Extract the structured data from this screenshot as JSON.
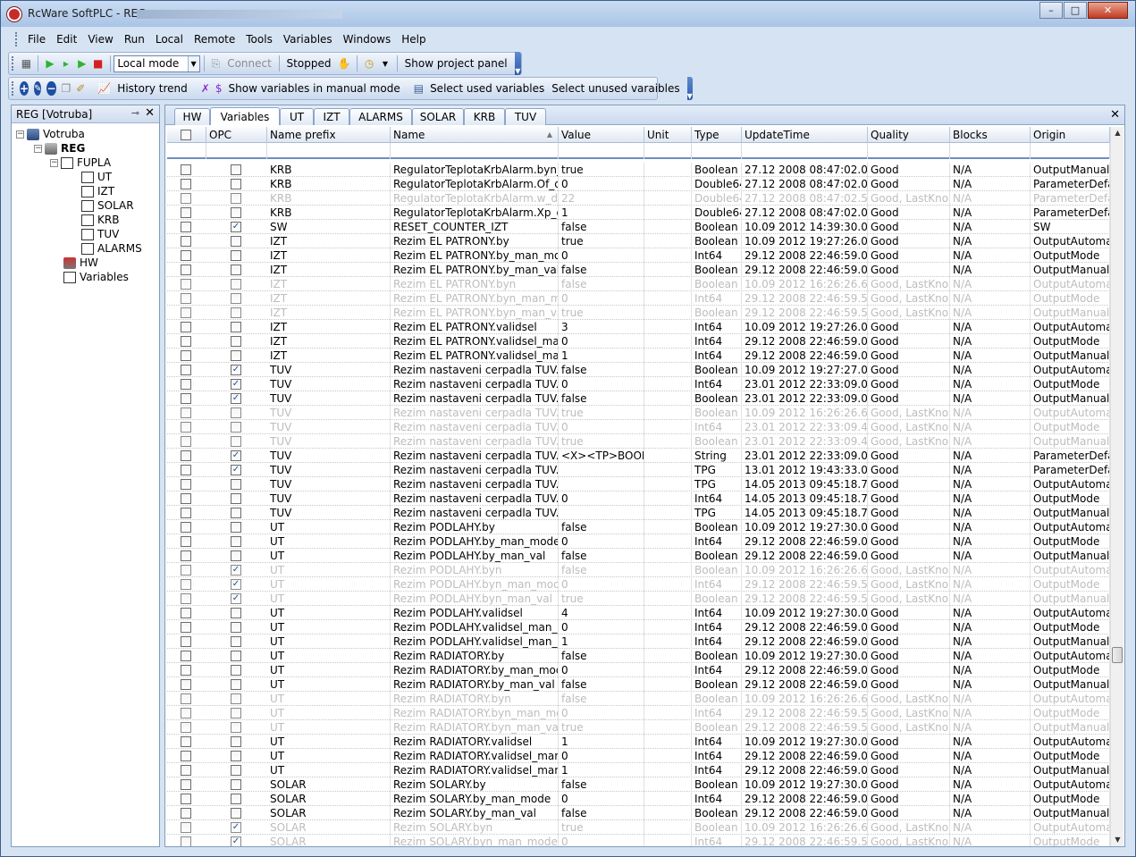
{
  "window": {
    "title": "RcWare SoftPLC - REG",
    "min": "–",
    "max": "□",
    "close": "✕"
  },
  "menu": [
    "File",
    "Edit",
    "View",
    "Run",
    "Local",
    "Remote",
    "Tools",
    "Variables",
    "Windows",
    "Help"
  ],
  "toolbar1": {
    "mode": "Local mode",
    "connect": "Connect",
    "stopped": "Stopped",
    "show_project_panel": "Show project panel"
  },
  "toolbar2": {
    "history_trend": "History trend",
    "show_manual": "Show variables in manual mode",
    "select_used": "Select used variables",
    "select_unused": "Select unused varaibles"
  },
  "left_panel": {
    "title": "REG [Votruba]",
    "tree": {
      "root": "Votruba",
      "reg": "REG",
      "fupla": "FUPLA",
      "children": [
        "UT",
        "IZT",
        "SOLAR",
        "KRB",
        "TUV",
        "ALARMS"
      ],
      "hw": "HW",
      "variables": "Variables"
    }
  },
  "tabs": [
    "HW",
    "Variables",
    "UT",
    "IZT",
    "ALARMS",
    "SOLAR",
    "KRB",
    "TUV"
  ],
  "active_tab": "Variables",
  "columns": [
    "OPC",
    "Name prefix",
    "Name",
    "Value",
    "Unit",
    "Type",
    "UpdateTime",
    "Quality",
    "Blocks",
    "Origin"
  ],
  "rows": [
    [
      "0",
      "KRB",
      "RegulatorTeplotaKrbAlarm.byn_m...",
      "true",
      "",
      "Boolean",
      "27.12 2008 08:47:02.000",
      "Good",
      "N/A",
      "OutputManual..."
    ],
    [
      "0",
      "KRB",
      "RegulatorTeplotaKrbAlarm.Of_def...",
      "0",
      "",
      "Double64",
      "27.12 2008 08:47:02.000",
      "Good",
      "N/A",
      "ParameterDefa..."
    ],
    [
      "d0",
      "KRB",
      "RegulatorTeplotaKrbAlarm.w_defa...",
      "22",
      "",
      "Double64",
      "27.12 2008 08:47:02.500",
      "Good, LastKno...",
      "N/A",
      "ParameterDefa..."
    ],
    [
      "0",
      "KRB",
      "RegulatorTeplotaKrbAlarm.Xp_def...",
      "1",
      "",
      "Double64",
      "27.12 2008 08:47:02.000",
      "Good",
      "N/A",
      "ParameterDefa..."
    ],
    [
      "1",
      "SW",
      "RESET_COUNTER_IZT",
      "false",
      "",
      "Boolean",
      "10.09 2012 14:39:30.000",
      "Good",
      "N/A",
      "SW"
    ],
    [
      "0",
      "IZT",
      "Rezim EL PATRONY.by",
      "true",
      "",
      "Boolean",
      "10.09 2012 19:27:26.000",
      "Good",
      "N/A",
      "OutputAutomat..."
    ],
    [
      "0",
      "IZT",
      "Rezim  EL  PATRONY.by_man_mo...",
      "0",
      "",
      "Int64",
      "29.12 2008 22:46:59.000",
      "Good",
      "N/A",
      "OutputMode"
    ],
    [
      "0",
      "IZT",
      "Rezim EL PATRONY.by_man_val",
      "false",
      "",
      "Boolean",
      "29.12 2008 22:46:59.000",
      "Good",
      "N/A",
      "OutputManual..."
    ],
    [
      "d0",
      "IZT",
      "Rezim  EL  PATRONY.byn",
      "false",
      "",
      "Boolean",
      "10.09 2012 16:26:26.609",
      "Good, LastKno...",
      "N/A",
      "OutputAutomat..."
    ],
    [
      "d0",
      "IZT",
      "Rezim  EL  PATRONY.byn_man_m...",
      "0",
      "",
      "Int64",
      "29.12 2008 22:46:59.546",
      "Good, LastKno...",
      "N/A",
      "OutputMode"
    ],
    [
      "d0",
      "IZT",
      "Rezim  EL  PATRONY.byn_man_val",
      "true",
      "",
      "Boolean",
      "29.12 2008 22:46:59.546",
      "Good, LastKno...",
      "N/A",
      "OutputManual..."
    ],
    [
      "0",
      "IZT",
      "Rezim EL PATRONY.validsel",
      "3",
      "",
      "Int64",
      "10.09 2012 19:27:26.000",
      "Good",
      "N/A",
      "OutputAutomat..."
    ],
    [
      "0",
      "IZT",
      "Rezim  EL  PATRONY.validsel_ma...",
      "0",
      "",
      "Int64",
      "29.12 2008 22:46:59.000",
      "Good",
      "N/A",
      "OutputMode"
    ],
    [
      "0",
      "IZT",
      "Rezim  EL  PATRONY.validsel_ma...",
      "1",
      "",
      "Int64",
      "29.12 2008 22:46:59.000",
      "Good",
      "N/A",
      "OutputManual..."
    ],
    [
      "1",
      "TUV",
      "Rezim nastaveni cerpadla TUV.by",
      "false",
      "",
      "Boolean",
      "10.09 2012 19:27:27.000",
      "Good",
      "N/A",
      "OutputAutomat..."
    ],
    [
      "1",
      "TUV",
      "Rezim nastaveni cerpadla TUV.by...",
      "0",
      "",
      "Int64",
      "23.01 2012 22:33:09.000",
      "Good",
      "N/A",
      "OutputMode"
    ],
    [
      "1",
      "TUV",
      "Rezim nastaveni cerpadla TUV.by...",
      "false",
      "",
      "Boolean",
      "23.01 2012 22:33:09.000",
      "Good",
      "N/A",
      "OutputManual..."
    ],
    [
      "d0",
      "TUV",
      "Rezim nastaveni cerpadla TUV.byn",
      "true",
      "",
      "Boolean",
      "10.09 2012 16:26:26.609",
      "Good, LastKno...",
      "N/A",
      "OutputAutomat..."
    ],
    [
      "d0",
      "TUV",
      "Rezim nastaveni cerpadla TUV.by...",
      "0",
      "",
      "Int64",
      "23.01 2012 22:33:09.462",
      "Good, LastKno...",
      "N/A",
      "OutputMode"
    ],
    [
      "d0",
      "TUV",
      "Rezim nastaveni cerpadla TUV.by...",
      "true",
      "",
      "Boolean",
      "23.01 2012 22:33:09.462",
      "Good, LastKno...",
      "N/A",
      "OutputManual..."
    ],
    [
      "1",
      "TUV",
      "Rezim nastaveni cerpadla TUV.inn...",
      "<X><TP>BOOL...",
      "",
      "String",
      "23.01 2012 22:33:09.000",
      "Good",
      "N/A",
      "ParameterDefa..."
    ],
    [
      "1",
      "TUV",
      "Rezim nastaveni cerpadla TUV.TP...",
      "",
      "",
      "TPG",
      "13.01 2012 19:43:33.000",
      "Good",
      "N/A",
      "ParameterDefa..."
    ],
    [
      "0",
      "TUV",
      "Rezim nastaveni cerpadla TUV.tpg...",
      "",
      "",
      "TPG",
      "14.05 2013 09:45:18.726",
      "Good",
      "N/A",
      "OutputAutomat..."
    ],
    [
      "0",
      "TUV",
      "Rezim nastaveni cerpadla TUV.tpg...",
      "0",
      "",
      "Int64",
      "14.05 2013 09:45:18.726",
      "Good",
      "N/A",
      "OutputMode"
    ],
    [
      "0",
      "TUV",
      "Rezim nastaveni cerpadla TUV.tpg...",
      "",
      "",
      "TPG",
      "14.05 2013 09:45:18.726",
      "Good",
      "N/A",
      "OutputManual..."
    ],
    [
      "0",
      "UT",
      "Rezim PODLAHY.by",
      "false",
      "",
      "Boolean",
      "10.09 2012 19:27:30.000",
      "Good",
      "N/A",
      "OutputAutomat..."
    ],
    [
      "0",
      "UT",
      "Rezim PODLAHY.by_man_mode",
      "0",
      "",
      "Int64",
      "29.12 2008 22:46:59.000",
      "Good",
      "N/A",
      "OutputMode"
    ],
    [
      "0",
      "UT",
      "Rezim PODLAHY.by_man_val",
      "false",
      "",
      "Boolean",
      "29.12 2008 22:46:59.000",
      "Good",
      "N/A",
      "OutputManual..."
    ],
    [
      "d1",
      "UT",
      "Rezim PODLAHY.byn",
      "false",
      "",
      "Boolean",
      "10.09 2012 16:26:26.609",
      "Good, LastKno...",
      "N/A",
      "OutputAutomat..."
    ],
    [
      "d1",
      "UT",
      "Rezim PODLAHY.byn_man_mode",
      "0",
      "",
      "Int64",
      "29.12 2008 22:46:59.546",
      "Good, LastKno...",
      "N/A",
      "OutputMode"
    ],
    [
      "d1",
      "UT",
      "Rezim PODLAHY.byn_man_val",
      "true",
      "",
      "Boolean",
      "29.12 2008 22:46:59.546",
      "Good, LastKno...",
      "N/A",
      "OutputManual..."
    ],
    [
      "0",
      "UT",
      "Rezim PODLAHY.validsel",
      "4",
      "",
      "Int64",
      "10.09 2012 19:27:30.000",
      "Good",
      "N/A",
      "OutputAutomat..."
    ],
    [
      "0",
      "UT",
      "Rezim  PODLAHY.validsel_man_m...",
      "0",
      "",
      "Int64",
      "29.12 2008 22:46:59.000",
      "Good",
      "N/A",
      "OutputMode"
    ],
    [
      "0",
      "UT",
      "Rezim PODLAHY.validsel_man_val",
      "1",
      "",
      "Int64",
      "29.12 2008 22:46:59.000",
      "Good",
      "N/A",
      "OutputManual..."
    ],
    [
      "0",
      "UT",
      "Rezim RADIATORY.by",
      "false",
      "",
      "Boolean",
      "10.09 2012 19:27:30.000",
      "Good",
      "N/A",
      "OutputAutomat..."
    ],
    [
      "0",
      "UT",
      "Rezim RADIATORY.by_man_mode",
      "0",
      "",
      "Int64",
      "29.12 2008 22:46:59.000",
      "Good",
      "N/A",
      "OutputMode"
    ],
    [
      "0",
      "UT",
      "Rezim RADIATORY.by_man_val",
      "false",
      "",
      "Boolean",
      "29.12 2008 22:46:59.000",
      "Good",
      "N/A",
      "OutputManual..."
    ],
    [
      "d0",
      "UT",
      "Rezim RADIATORY.byn",
      "false",
      "",
      "Boolean",
      "10.09 2012 16:26:26.609",
      "Good, LastKno...",
      "N/A",
      "OutputAutomat..."
    ],
    [
      "d0",
      "UT",
      "Rezim  RADIATORY.byn_man_mo...",
      "0",
      "",
      "Int64",
      "29.12 2008 22:46:59.546",
      "Good, LastKno...",
      "N/A",
      "OutputMode"
    ],
    [
      "d0",
      "UT",
      "Rezim RADIATORY.byn_man_val",
      "true",
      "",
      "Boolean",
      "29.12 2008 22:46:59.546",
      "Good, LastKno...",
      "N/A",
      "OutputManual..."
    ],
    [
      "0",
      "UT",
      "Rezim RADIATORY.validsel",
      "1",
      "",
      "Int64",
      "10.09 2012 19:27:30.000",
      "Good",
      "N/A",
      "OutputAutomat..."
    ],
    [
      "0",
      "UT",
      "Rezim  RADIATORY.validsel_man...",
      "0",
      "",
      "Int64",
      "29.12 2008 22:46:59.000",
      "Good",
      "N/A",
      "OutputMode"
    ],
    [
      "0",
      "UT",
      "Rezim  RADIATORY.validsel_man...",
      "1",
      "",
      "Int64",
      "29.12 2008 22:46:59.000",
      "Good",
      "N/A",
      "OutputManual..."
    ],
    [
      "0",
      "SOLAR",
      "Rezim SOLARY.by",
      "false",
      "",
      "Boolean",
      "10.09 2012 19:27:30.000",
      "Good",
      "N/A",
      "OutputAutomat..."
    ],
    [
      "0",
      "SOLAR",
      "Rezim SOLARY.by_man_mode",
      "0",
      "",
      "Int64",
      "29.12 2008 22:46:59.000",
      "Good",
      "N/A",
      "OutputMode"
    ],
    [
      "0",
      "SOLAR",
      "Rezim SOLARY.by_man_val",
      "false",
      "",
      "Boolean",
      "29.12 2008 22:46:59.000",
      "Good",
      "N/A",
      "OutputManual..."
    ],
    [
      "d1",
      "SOLAR",
      "Rezim SOLARY.byn",
      "true",
      "",
      "Boolean",
      "10.09 2012 16:26:26.609",
      "Good, LastKno...",
      "N/A",
      "OutputAutomat..."
    ],
    [
      "d1",
      "SOLAR",
      "Rezim SOLARY.byn_man_mode",
      "0",
      "",
      "Int64",
      "29.12 2008 22:46:59.546",
      "Good, LastKno...",
      "N/A",
      "OutputMode"
    ]
  ]
}
